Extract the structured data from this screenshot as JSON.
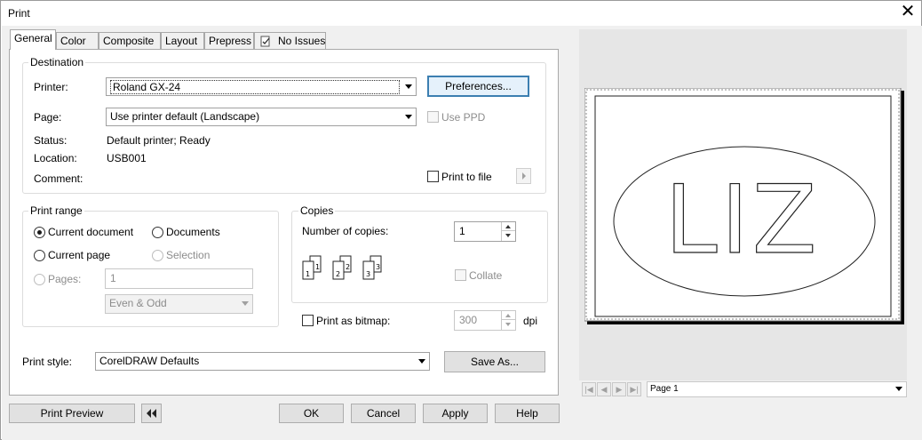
{
  "window": {
    "title": "Print",
    "close_glyph": "✕"
  },
  "tabs": [
    "General",
    "Color",
    "Composite",
    "Layout",
    "Prepress",
    "No Issues"
  ],
  "destination": {
    "group_label": "Destination",
    "printer_label": "Printer:",
    "printer_value": "Roland GX-24",
    "preferences_button": "Preferences...",
    "page_label": "Page:",
    "page_value": "Use printer default (Landscape)",
    "use_ppd_label": "Use PPD",
    "status_label": "Status:",
    "status_value": "Default printer; Ready",
    "location_label": "Location:",
    "location_value": "USB001",
    "comment_label": "Comment:",
    "print_to_file_label": "Print to file"
  },
  "print_range": {
    "group_label": "Print range",
    "current_document": "Current document",
    "documents": "Documents",
    "current_page": "Current page",
    "selection": "Selection",
    "pages_label": "Pages:",
    "pages_value": "1",
    "even_odd_value": "Even & Odd"
  },
  "copies": {
    "group_label": "Copies",
    "number_label": "Number of copies:",
    "number_value": "1",
    "collate_label": "Collate"
  },
  "bitmap": {
    "label": "Print as bitmap:",
    "value": "300",
    "unit": "dpi"
  },
  "print_style": {
    "label": "Print style:",
    "value": "CorelDRAW Defaults",
    "save_as_button": "Save As..."
  },
  "bottom_buttons": {
    "print_preview": "Print Preview",
    "ok": "OK",
    "cancel": "Cancel",
    "apply": "Apply",
    "help": "Help"
  },
  "preview": {
    "artwork_text": "LIZ",
    "page_select_value": "Page 1"
  }
}
